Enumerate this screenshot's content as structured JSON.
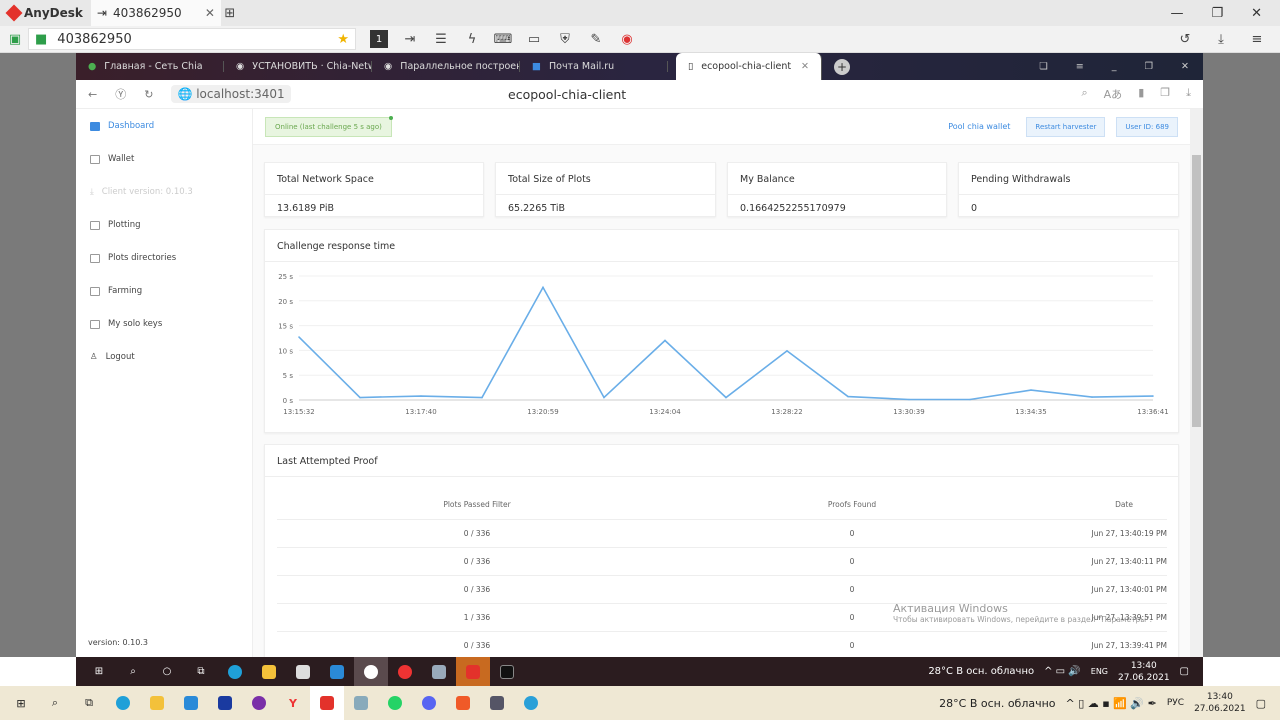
{
  "anydesk": {
    "app_name": "AnyDesk",
    "tab_label": "403862950",
    "address_value": "403862950",
    "session_number": "1"
  },
  "browser": {
    "tabs": [
      {
        "label": "Главная - Сеть Chia"
      },
      {
        "label": "УСТАНОВИТЬ · Chia-Netw"
      },
      {
        "label": "Параллельное построени"
      },
      {
        "label": "Почта Mail.ru"
      },
      {
        "label": "ecopool-chia-client"
      }
    ],
    "url": "localhost:3401",
    "page_title": "ecopool-chia-client"
  },
  "sidebar": {
    "items": [
      {
        "label": "Dashboard"
      },
      {
        "label": "Wallet"
      },
      {
        "label": "Client version: 0.10.3"
      },
      {
        "label": "Plotting"
      },
      {
        "label": "Plots directories"
      },
      {
        "label": "Farming"
      },
      {
        "label": "My solo keys"
      },
      {
        "label": "Logout"
      }
    ],
    "version": "version: 0.10.3"
  },
  "topbar": {
    "status": "Online (last challenge 5 s ago)",
    "pool_wallet": "Pool chia wallet",
    "restart": "Restart harvester",
    "user": "User ID: 689"
  },
  "stats": [
    {
      "label": "Total Network Space",
      "value": "13.6189 PiB"
    },
    {
      "label": "Total Size of Plots",
      "value": "65.2265 TiB"
    },
    {
      "label": "My Balance",
      "value": "0.1664252255170979"
    },
    {
      "label": "Pending Withdrawals",
      "value": "0"
    }
  ],
  "chart_data": {
    "type": "line",
    "title": "Challenge response time",
    "ylim": [
      0,
      25
    ],
    "yticks": [
      "0 s",
      "5 s",
      "10 s",
      "15 s",
      "20 s",
      "25 s"
    ],
    "x_labels": [
      "13:15:32",
      "13:17:40",
      "13:20:59",
      "13:24:04",
      "13:28:22",
      "13:30:39",
      "13:34:35",
      "13:36:41"
    ],
    "values": [
      12.7,
      0.5,
      0.8,
      0.5,
      22.7,
      0.5,
      12,
      0.5,
      9.9,
      0.7,
      0.1,
      0.1,
      2,
      0.6,
      0.8
    ],
    "color": "#6aaee8"
  },
  "proofs": {
    "title": "Last Attempted Proof",
    "headers": [
      "Plots Passed Filter",
      "Proofs Found",
      "Date"
    ],
    "rows": [
      [
        "0 / 336",
        "0",
        "Jun 27, 13:40:19 PM"
      ],
      [
        "0 / 336",
        "0",
        "Jun 27, 13:40:11 PM"
      ],
      [
        "0 / 336",
        "0",
        "Jun 27, 13:40:01 PM"
      ],
      [
        "1 / 336",
        "0",
        "Jun 27, 13:39:51 PM"
      ],
      [
        "0 / 336",
        "0",
        "Jun 27, 13:39:41 PM"
      ]
    ]
  },
  "watermark": {
    "title": "Активация Windows",
    "text": "Чтобы активировать Windows, перейдите в раздел \"Параметры\"."
  },
  "remote_taskbar": {
    "weather": "28°C  В осн. облачно",
    "lang": "ENG",
    "time": "13:40",
    "date": "27.06.2021"
  },
  "local_taskbar": {
    "weather": "28°C  В осн. облачно",
    "lang": "РУС",
    "time": "13:40",
    "date": "27.06.2021"
  }
}
